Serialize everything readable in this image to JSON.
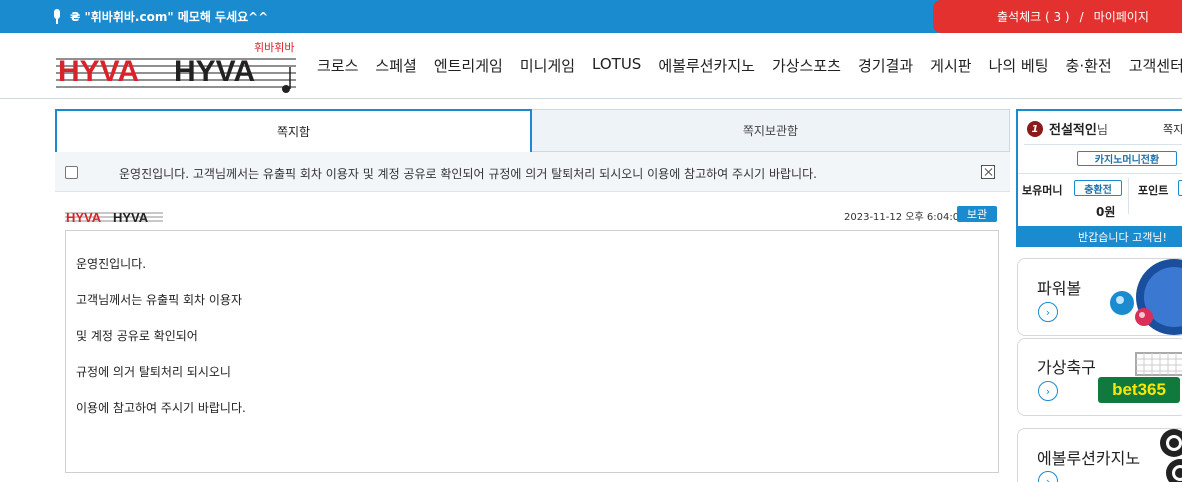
{
  "topbar": {
    "memo": "₴ \"휘바휘바.com\" 메모해 두세요^^",
    "attendance": "출석체크 ( 3 )",
    "separator": "/",
    "mypage": "마이페이지"
  },
  "header": {
    "logo_sub": "휘바휘바",
    "nav": [
      "크로스",
      "스페셜",
      "엔트리게임",
      "미니게임",
      "LOTUS",
      "에볼루션카지노",
      "가상스포츠",
      "경기결과",
      "게시판",
      "나의 베팅",
      "충·환전",
      "고객센터"
    ]
  },
  "tabs": {
    "inbox": "쪽지함",
    "saved": "쪽지보관함"
  },
  "notice": {
    "text": "운영진입니다. 고객님께서는 유출픽 회차 이용자 및 계정 공유로 확인되어 규정에 의거 탈퇴처리 되시오니 이용에 참고하여 주시기 바랍니다."
  },
  "message": {
    "date": "2023-11-12 오후 6:04:00",
    "keep_label": "보관",
    "lines": [
      "운영진입니다.",
      "고객님께서는 유출픽 회차 이용자",
      "및 계정 공유로 확인되어",
      "규정에 의거 탈퇴처리 되시오니",
      "이용에 참고하여 주시기 바랍니다."
    ]
  },
  "user": {
    "rank_num": "1",
    "name": "전설적인",
    "name_suffix": "님",
    "jokji": "쪽지",
    "casino_btn": "카지노머니전환",
    "money_label": "보유머니",
    "charge_btn": "충환전",
    "point_label": "포인트",
    "money_value": "0원",
    "welcome": "반갑습니다 고객님!"
  },
  "games": [
    {
      "name": "파워볼"
    },
    {
      "name": "가상축구",
      "badge": "bet365"
    },
    {
      "name": "에볼루션카지노"
    }
  ],
  "colors": {
    "primary": "#1b8bcf",
    "accent_red": "#e2312f"
  }
}
